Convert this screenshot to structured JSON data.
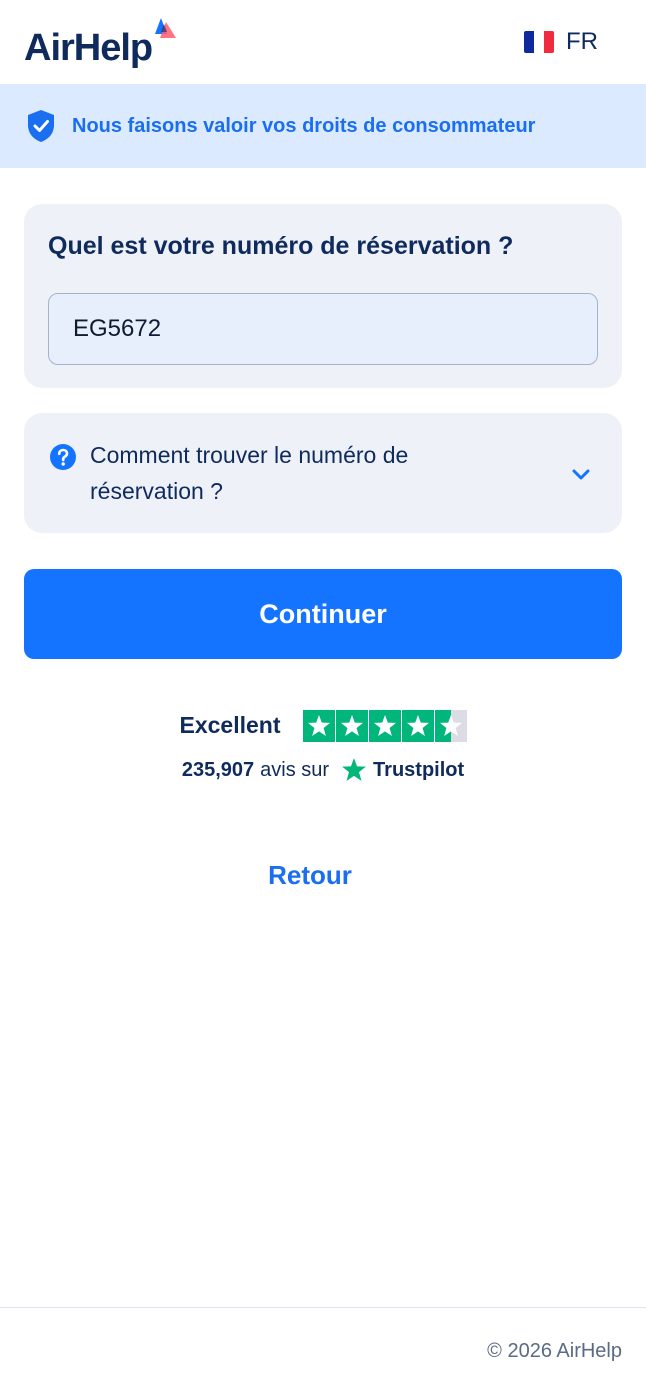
{
  "header": {
    "logo_text": "AirHelp",
    "language_code": "FR",
    "flag_colors": [
      "#0f2a9c",
      "#ffffff",
      "#ef2b3d"
    ]
  },
  "banner": {
    "text": "Nous faisons valoir vos droits de consommateur",
    "icon": "shield-check-icon"
  },
  "booking_form": {
    "question": "Quel est votre numéro de réservation ?",
    "input_value": "EG5672",
    "input_placeholder": ""
  },
  "help": {
    "icon": "question-circle-icon",
    "text": "Comment trouver le numéro de réservation ?",
    "expand_icon": "chevron-down-icon"
  },
  "actions": {
    "continue_label": "Continuer",
    "back_label": "Retour"
  },
  "trustpilot": {
    "rating_label": "Excellent",
    "stars_filled": 4.5,
    "stars_total": 5,
    "review_count": "235,907",
    "review_text": "avis sur",
    "brand": "Trustpilot"
  },
  "footer": {
    "copyright": "© 2026 AirHelp"
  },
  "colors": {
    "brand_navy": "#0f2a5c",
    "accent_blue": "#1474ff",
    "banner_bg": "#dceaff",
    "trustpilot_green": "#00b67a"
  }
}
